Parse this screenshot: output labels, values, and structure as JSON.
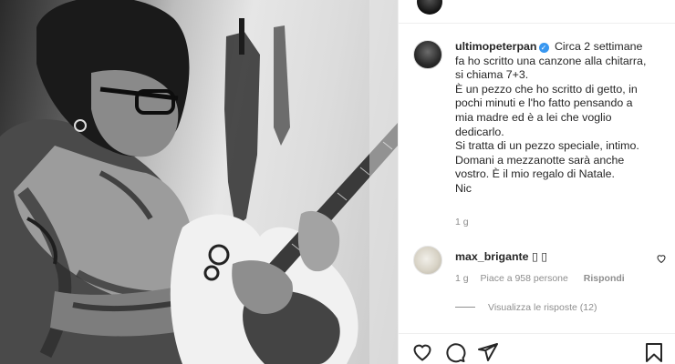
{
  "post": {
    "image_alt": "Black and white photo of a tattooed man with glasses playing an electric guitar"
  },
  "caption": {
    "username": "ultimopeterpan",
    "verified_icon": "verified-badge-icon",
    "lines": [
      "Circa 2 settimane",
      "fa ho scritto una canzone alla chitarra,",
      "si chiama 7+3.",
      "È un pezzo che ho scritto di getto, in",
      "pochi minuti e l'ho fatto pensando a",
      "mia madre ed è a lei che voglio",
      "dedicarlo.",
      "Si tratta di un pezzo speciale, intimo.",
      "Domani a mezzanotte sarà anche",
      "vostro. È il mio regalo di Natale.",
      "Nic"
    ],
    "time": "1 g"
  },
  "comment": {
    "username": "max_brigante",
    "text": "▯ ▯",
    "time": "1 g",
    "likes": "Piace a 958 persone",
    "reply_label": "Rispondi",
    "view_replies": "Visualizza le risposte (12)"
  },
  "actions": {
    "like_icon": "heart-icon",
    "comment_icon": "comment-icon",
    "share_icon": "share-icon",
    "save_icon": "bookmark-icon"
  },
  "colors": {
    "accent_verified": "#3897f0",
    "text_primary": "#262626",
    "text_secondary": "#8e8e8e",
    "border": "#efefef"
  }
}
